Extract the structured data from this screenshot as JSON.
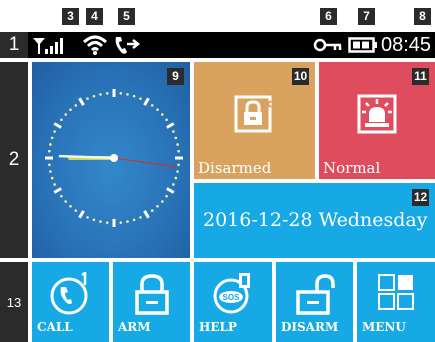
{
  "markers": {
    "m1": "1",
    "m2": "2",
    "m3": "3",
    "m4": "4",
    "m5": "5",
    "m6": "6",
    "m7": "7",
    "m8": "8",
    "m9": "9",
    "m10": "10",
    "m11": "11",
    "m12": "12",
    "m13": "13"
  },
  "status": {
    "time": "08:45"
  },
  "tiles": {
    "clock": {
      "hour_deg": -88,
      "minute_deg": -95,
      "second_deg": 82
    },
    "disarmed": {
      "label": "Disarmed",
      "color": "#d9a25e"
    },
    "normal": {
      "label": "Normal",
      "color": "#df4c5d"
    },
    "date": {
      "text": "2016-12-28 Wednesday",
      "color": "#17a8e6"
    }
  },
  "buttons": [
    {
      "label": "CALL",
      "icon": "phone-icon"
    },
    {
      "label": "ARM",
      "icon": "padlock-closed-icon"
    },
    {
      "label": "HELP",
      "icon": "sos-icon"
    },
    {
      "label": "DISARM",
      "icon": "padlock-open-icon"
    },
    {
      "label": "MENU",
      "icon": "grid-menu-icon"
    }
  ],
  "colors": {
    "accent_blue": "#17a8e6",
    "label_bg": "#2b2b2b",
    "clock_bg": "#2a73b9"
  }
}
